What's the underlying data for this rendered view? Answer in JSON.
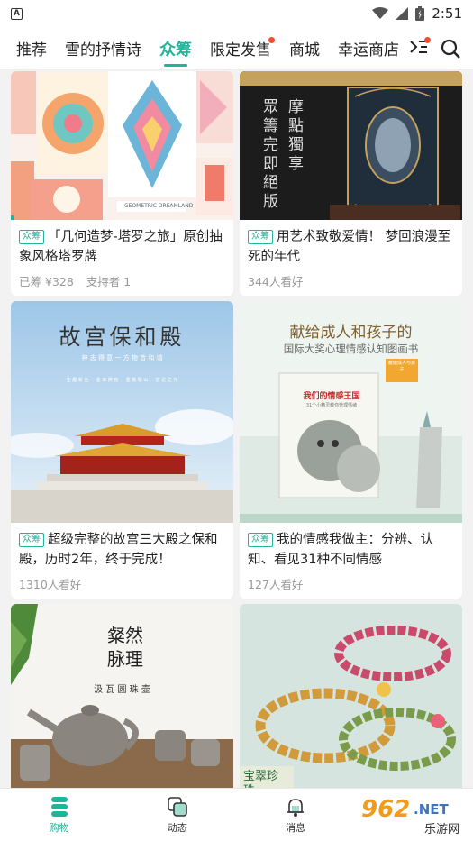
{
  "status_bar": {
    "time": "2:51",
    "notification_letter": "A"
  },
  "nav": {
    "tabs": [
      {
        "label": "推荐"
      },
      {
        "label": "雪的抒情诗"
      },
      {
        "label": "众筹"
      },
      {
        "label": "限定发售"
      },
      {
        "label": "商城"
      },
      {
        "label": "幸运商店"
      }
    ]
  },
  "cards": [
    {
      "tag": "众筹",
      "title": "「几何造梦-塔罗之旅」原创抽象风格塔罗牌",
      "meta1": "已筹 ¥328",
      "meta2": "支持者 1",
      "image_text": "GEOMETRIC DREAMLAND"
    },
    {
      "tag": "众筹",
      "title": "用艺术致敬爱情！ 梦回浪漫至死的年代",
      "meta1": "344人看好",
      "image_text_col1": "眾籌完即絕版",
      "image_text_col2": "摩點獨享"
    },
    {
      "tag": "众筹",
      "title": "超级完整的故宫三大殿之保和殿，历时2年，终于完成！",
      "meta1": "1310人看好",
      "image_title": "故宫保和殿",
      "image_sub": "神 志 得 意 一  方 物 皆 和 谐",
      "image_sub2": "生 趣 新 色 　 金 琢 拱 宫 　 重 檐 歇 山 　 宏 达 之 作"
    },
    {
      "tag": "众筹",
      "title": "我的情感我做主：分辨、认知、看见31种不同情感",
      "meta1": "127人看好",
      "image_title": "献给成人和孩子的",
      "image_sub": "国际大奖心理情感认知图画书",
      "book_title": "我们的情感王国",
      "book_sub": "31个小精灵教你管理情绪",
      "badge": "献给成人与孩子"
    },
    {
      "image_title": "粲然脉理",
      "image_sub": "汲 瓦 圆 珠 壶"
    },
    {
      "image_text": "宝翠珍珠"
    }
  ],
  "bottom_nav": [
    {
      "label": "购物"
    },
    {
      "label": "动态"
    },
    {
      "label": "消息"
    }
  ],
  "watermark": {
    "text": "962",
    "suffix": ".NET",
    "sub": "乐游网"
  },
  "colors": {
    "accent": "#1fb59a",
    "badge_red": "#f04e2e"
  }
}
